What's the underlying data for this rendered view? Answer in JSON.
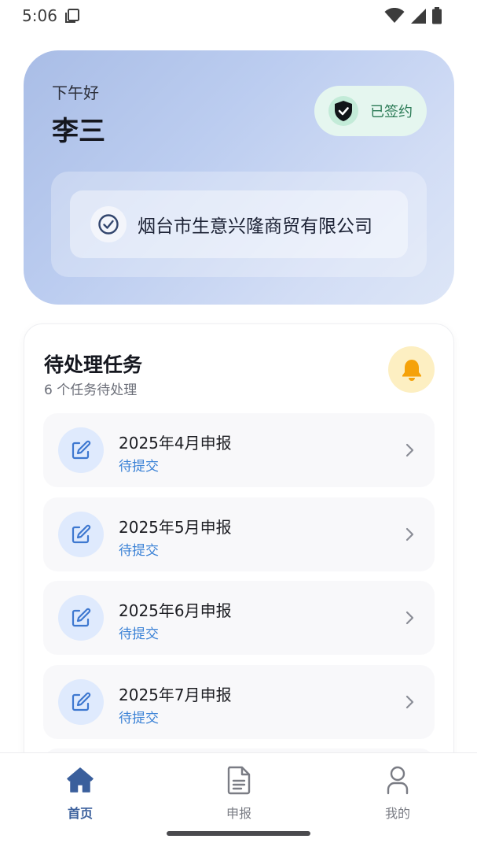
{
  "status_bar": {
    "time": "5:06"
  },
  "header": {
    "greeting": "下午好",
    "user_name": "李三",
    "sign_status": "已签约",
    "company_name": "烟台市生意兴隆商贸有限公司"
  },
  "tasks": {
    "title": "待处理任务",
    "subtitle": "6 个任务待处理",
    "items": [
      {
        "title": "2025年4月申报",
        "status": "待提交"
      },
      {
        "title": "2025年5月申报",
        "status": "待提交"
      },
      {
        "title": "2025年6月申报",
        "status": "待提交"
      },
      {
        "title": "2025年7月申报",
        "status": "待提交"
      }
    ]
  },
  "nav": {
    "items": [
      {
        "label": "首页",
        "icon": "home-icon",
        "active": true
      },
      {
        "label": "申报",
        "icon": "document-icon",
        "active": false
      },
      {
        "label": "我的",
        "icon": "person-icon",
        "active": false
      }
    ]
  },
  "colors": {
    "accent": "#3a5f9c",
    "task_status": "#3b82d6",
    "sign_badge_bg": "#e5f6ef",
    "bell_bg": "#fdefc2",
    "bell": "#f5a20a"
  }
}
